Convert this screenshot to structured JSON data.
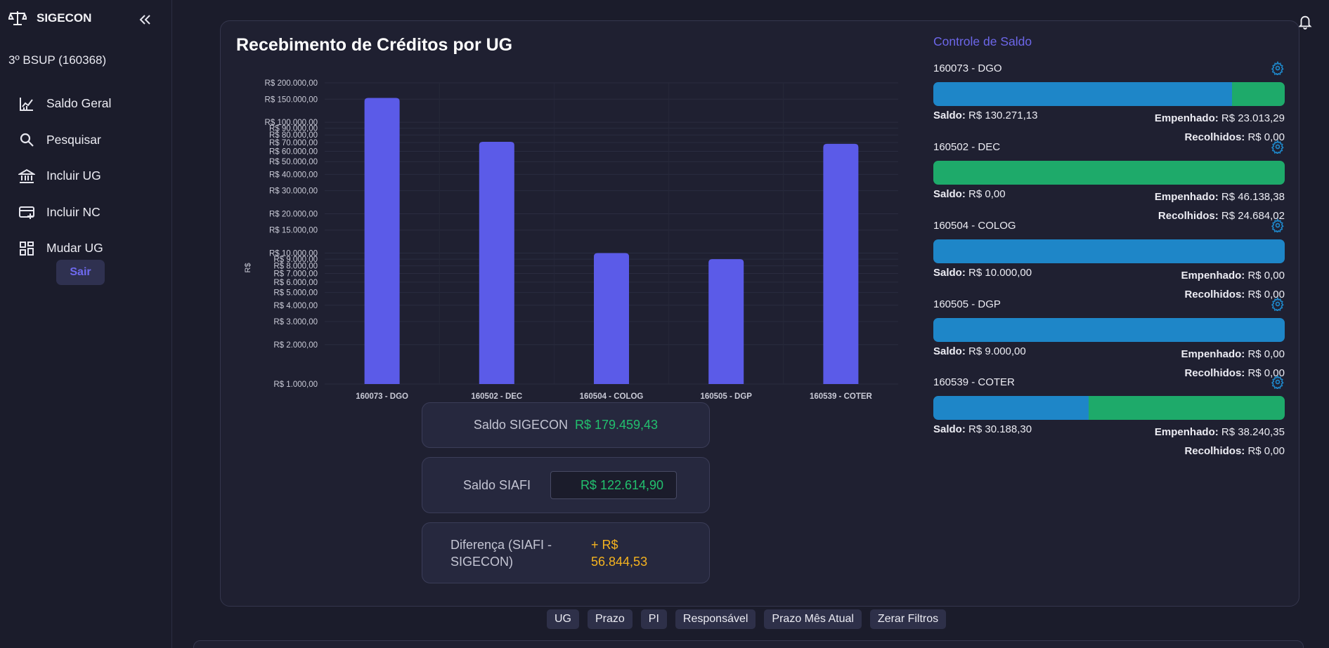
{
  "app": {
    "name": "SIGECON",
    "unit": "3º BSUP (160368)"
  },
  "sidebar": {
    "items": [
      {
        "label": "Saldo Geral",
        "icon": "chart-icon"
      },
      {
        "label": "Pesquisar",
        "icon": "search-icon"
      },
      {
        "label": "Incluir UG",
        "icon": "bank-icon"
      },
      {
        "label": "Incluir NC",
        "icon": "card-add-icon"
      },
      {
        "label": "Mudar UG",
        "icon": "dashboard-icon"
      }
    ],
    "logout_label": "Sair"
  },
  "main": {
    "title": "Recebimento de Créditos por UG",
    "summary": {
      "sigecon_label": "Saldo SIGECON",
      "sigecon_value": "R$ 179.459,43",
      "siafi_label": "Saldo SIAFI",
      "siafi_value": "R$ 122.614,90",
      "diff_label": "Diferença (SIAFI - SIGECON)",
      "diff_value": "+ R$ 56.844,53"
    }
  },
  "chart_data": {
    "type": "bar",
    "title": "Recebimento de Créditos por UG",
    "xlabel": "",
    "ylabel": "R$",
    "yscale": "log",
    "ylim": [
      1000,
      200000
    ],
    "color": "#5b5be8",
    "categories": [
      "160073 - DGO",
      "160502 - DEC",
      "160504 - COLOG",
      "160505 - DGP",
      "160539 - COTER"
    ],
    "values": [
      153284.42,
      70822.4,
      10000.0,
      9000.0,
      68428.65
    ],
    "ytick_labels": [
      "R$ 1.000,00",
      "R$ 2.000,00",
      "R$ 3.000,00",
      "R$ 4.000,00",
      "R$ 5.000,00",
      "R$ 6.000,00",
      "R$ 7.000,00",
      "R$ 8.000,00",
      "R$ 9.000,00",
      "R$ 10.000,00",
      "R$ 15.000,00",
      "R$ 20.000,00",
      "R$ 30.000,00",
      "R$ 40.000,00",
      "R$ 50.000,00",
      "R$ 60.000,00",
      "R$ 70.000,00",
      "R$ 80.000,00",
      "R$ 90.000,00",
      "R$ 100.000,00",
      "R$ 150.000,00",
      "R$ 200.000,00"
    ],
    "yticks": [
      1000,
      2000,
      3000,
      4000,
      5000,
      6000,
      7000,
      8000,
      9000,
      10000,
      15000,
      20000,
      30000,
      40000,
      50000,
      60000,
      70000,
      80000,
      90000,
      100000,
      150000,
      200000
    ],
    "grid": true
  },
  "controle": {
    "title": "Controle de Saldo",
    "saldo_label": "Saldo:",
    "empenhado_label": "Empenhado:",
    "recolhidos_label": "Recolhidos:",
    "ugs": [
      {
        "name": "160073 - DGO",
        "saldo": "R$ 130.271,13",
        "empenhado": "R$ 23.013,29",
        "recolhidos": "R$ 0,00",
        "saldo_fraction": 0.85
      },
      {
        "name": "160502 - DEC",
        "saldo": "R$ 0,00",
        "empenhado": "R$ 46.138,38",
        "recolhidos": "R$ 24.684,02",
        "saldo_fraction": 0.0
      },
      {
        "name": "160504 - COLOG",
        "saldo": "R$ 10.000,00",
        "empenhado": "R$ 0,00",
        "recolhidos": "R$ 0,00",
        "saldo_fraction": 1.0
      },
      {
        "name": "160505 - DGP",
        "saldo": "R$ 9.000,00",
        "empenhado": "R$ 0,00",
        "recolhidos": "R$ 0,00",
        "saldo_fraction": 1.0
      },
      {
        "name": "160539 - COTER",
        "saldo": "R$ 30.188,30",
        "empenhado": "R$ 38.240,35",
        "recolhidos": "R$ 0,00",
        "saldo_fraction": 0.441
      }
    ]
  },
  "filters": [
    "UG",
    "Prazo",
    "PI",
    "Responsável",
    "Prazo Mês Atual",
    "Zerar Filtros"
  ],
  "colors": {
    "accent": "#6d67ea",
    "bar": "#5b5be8",
    "saldo": "#1e86c8",
    "empenhado": "#1eaa6a",
    "positive": "#22c06e",
    "warning": "#f5b31f"
  }
}
